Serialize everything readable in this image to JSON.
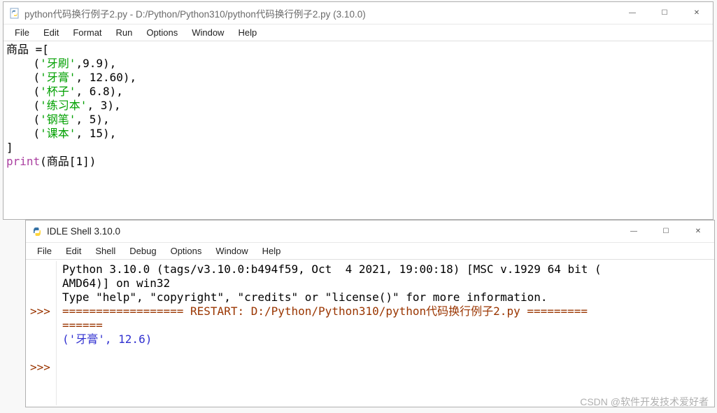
{
  "editor": {
    "title": "python代码换行例子2.py - D:/Python/Python310/python代码换行例子2.py (3.10.0)",
    "menus": [
      "File",
      "Edit",
      "Format",
      "Run",
      "Options",
      "Window",
      "Help"
    ],
    "code": {
      "line1_a": "商品 =[",
      "indent": "    ",
      "tuples": [
        {
          "s": "'牙刷'",
          "rest": ",9.9),"
        },
        {
          "s": "'牙膏'",
          "rest": ", 12.60),"
        },
        {
          "s": "'杯子'",
          "rest": ", 6.8),"
        },
        {
          "s": "'练习本'",
          "rest": ", 3),"
        },
        {
          "s": "'钢笔'",
          "rest": ", 5),"
        },
        {
          "s": "'课本'",
          "rest": ", 15),"
        }
      ],
      "close": "]",
      "print_kw": "print",
      "print_args": "(商品[1])"
    }
  },
  "shell": {
    "title": "IDLE Shell 3.10.0",
    "menus": [
      "File",
      "Edit",
      "Shell",
      "Debug",
      "Options",
      "Window",
      "Help"
    ],
    "banner_l1": "Python 3.10.0 (tags/v3.10.0:b494f59, Oct  4 2021, 19:00:18) [MSC v.1929 64 bit (",
    "banner_l2": "AMD64)] on win32",
    "banner_l3": "Type \"help\", \"copyright\", \"credits\" or \"license()\" for more information.",
    "restart_l1": "================== RESTART: D:/Python/Python310/python代码换行例子2.py =========",
    "restart_l2": "======",
    "output": "('牙膏', 12.6)",
    "prompt": ">>>"
  },
  "controls": {
    "min": "—",
    "max": "☐",
    "close": "✕"
  },
  "watermark": "CSDN @软件开发技术爱好者"
}
